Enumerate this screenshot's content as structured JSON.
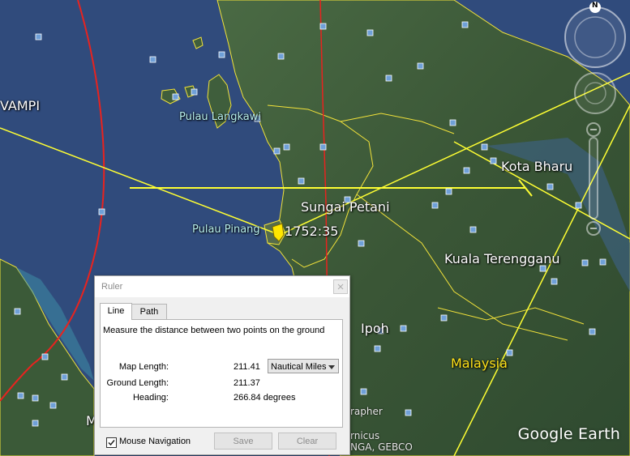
{
  "map": {
    "labels": {
      "vampi": "VAMPI",
      "pulau_langkawi": "Pulau Langkawi",
      "sungai_petani": "Sungai Petani",
      "kota_bharu": "Kota Bharu",
      "pulau_pinang": "Pulau Pinang",
      "placemark_label": "1752:35",
      "kuala_terengganu": "Kuala Terengganu",
      "ipoh": "Ipoh",
      "malaysia": "Malaysia",
      "partial_m": "M",
      "copyright_1": "rapher",
      "copyright_2": "rnicus",
      "copyright_3": "NGA, GEBCO"
    },
    "compass_letter": "N",
    "watermark": "Google Earth",
    "colors": {
      "ocean": "#2f4a7a",
      "land": "#3d5a3a",
      "route_red": "#e8231f",
      "measure_yellow": "#ffff33",
      "border_yellow": "#f2e23a"
    }
  },
  "ruler": {
    "title": "Ruler",
    "tabs": [
      {
        "label": "Line",
        "active": true
      },
      {
        "label": "Path",
        "active": false
      }
    ],
    "description": "Measure the distance between two points on the ground",
    "map_length_label": "Map Length:",
    "map_length_value": "211.41",
    "unit": "Nautical Miles",
    "ground_length_label": "Ground Length:",
    "ground_length_value": "211.37",
    "heading_label": "Heading:",
    "heading_value": "266.84 degrees",
    "mouse_navigation_label": "Mouse Navigation",
    "mouse_navigation_checked": true,
    "save_label": "Save",
    "clear_label": "Clear"
  }
}
